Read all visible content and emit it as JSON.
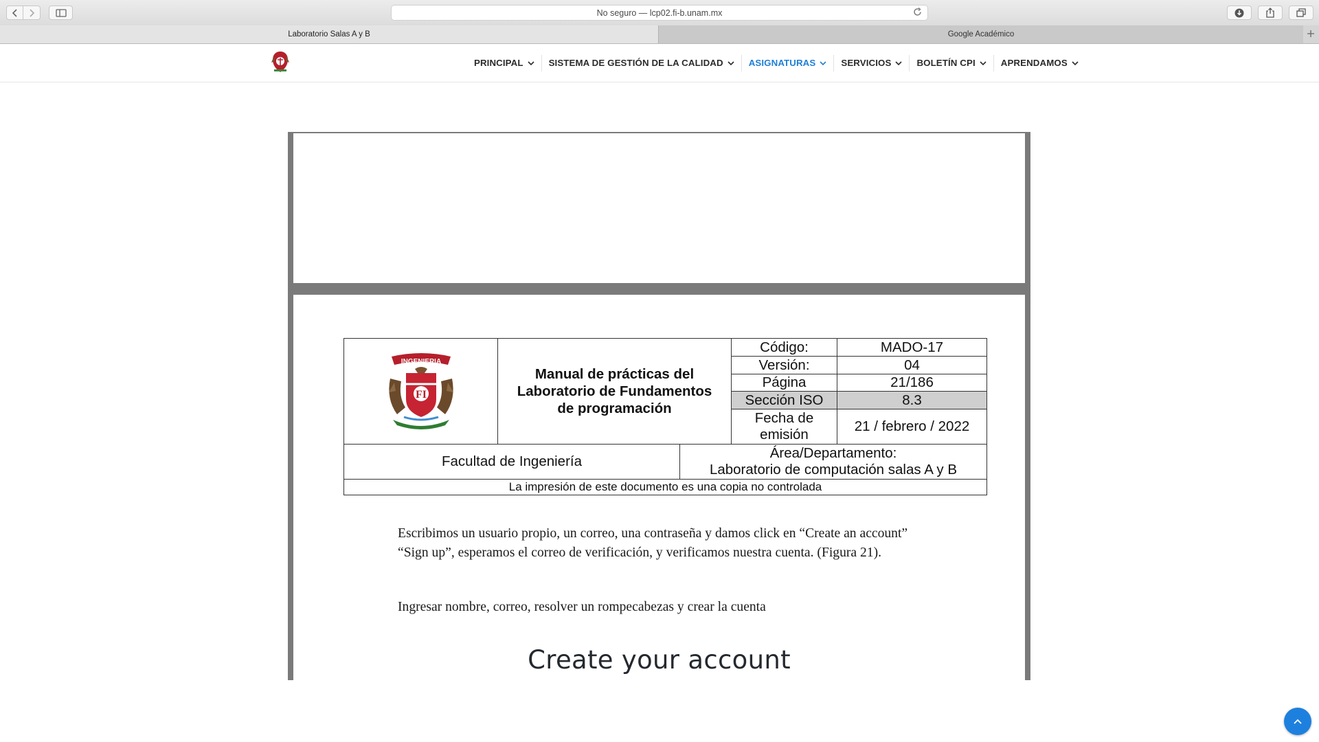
{
  "browser": {
    "address": "No seguro — lcp02.fi-b.unam.mx",
    "tabs": [
      {
        "label": "Laboratorio Salas A y B",
        "active": true
      },
      {
        "label": "Google Académico",
        "active": false
      }
    ]
  },
  "site": {
    "nav": [
      {
        "label": "PRINCIPAL",
        "active": false
      },
      {
        "label": "SISTEMA DE GESTIÓN DE LA CALIDAD",
        "active": false
      },
      {
        "label": "ASIGNATURAS",
        "active": true
      },
      {
        "label": "SERVICIOS",
        "active": false
      },
      {
        "label": "BOLETÍN CPI",
        "active": false
      },
      {
        "label": "APRENDAMOS",
        "active": false
      }
    ],
    "accent_color": "#1e7fd6"
  },
  "document": {
    "header": {
      "title": "Manual de prácticas del Laboratorio de Fundamentos de programación",
      "codigo_label": "Código:",
      "codigo_value": "MADO-17",
      "version_label": "Versión:",
      "version_value": "04",
      "pagina_label": "Página",
      "pagina_value": "21/186",
      "iso_label": "Sección ISO",
      "iso_value": "8.3",
      "fecha_label": "Fecha de emisión",
      "fecha_value": "21 / febrero / 2022",
      "facultad": "Facultad de Ingeniería",
      "area_label": "Área/Departamento:",
      "area_value": "Laboratorio de computación salas A y B",
      "footer_note": "La impresión de este documento es una copia no controlada",
      "logo_text": "INGENIERIA"
    },
    "paragraph1": "Escribimos un usuario propio, un correo, una contraseña y damos click en “Create an account” “Sign up”, esperamos el correo de verificación, y verificamos nuestra cuenta. (Figura 21).",
    "paragraph2": "Ingresar nombre, correo, resolver un rompecabezas y crear la cuenta",
    "figure_heading": "Create your account"
  }
}
